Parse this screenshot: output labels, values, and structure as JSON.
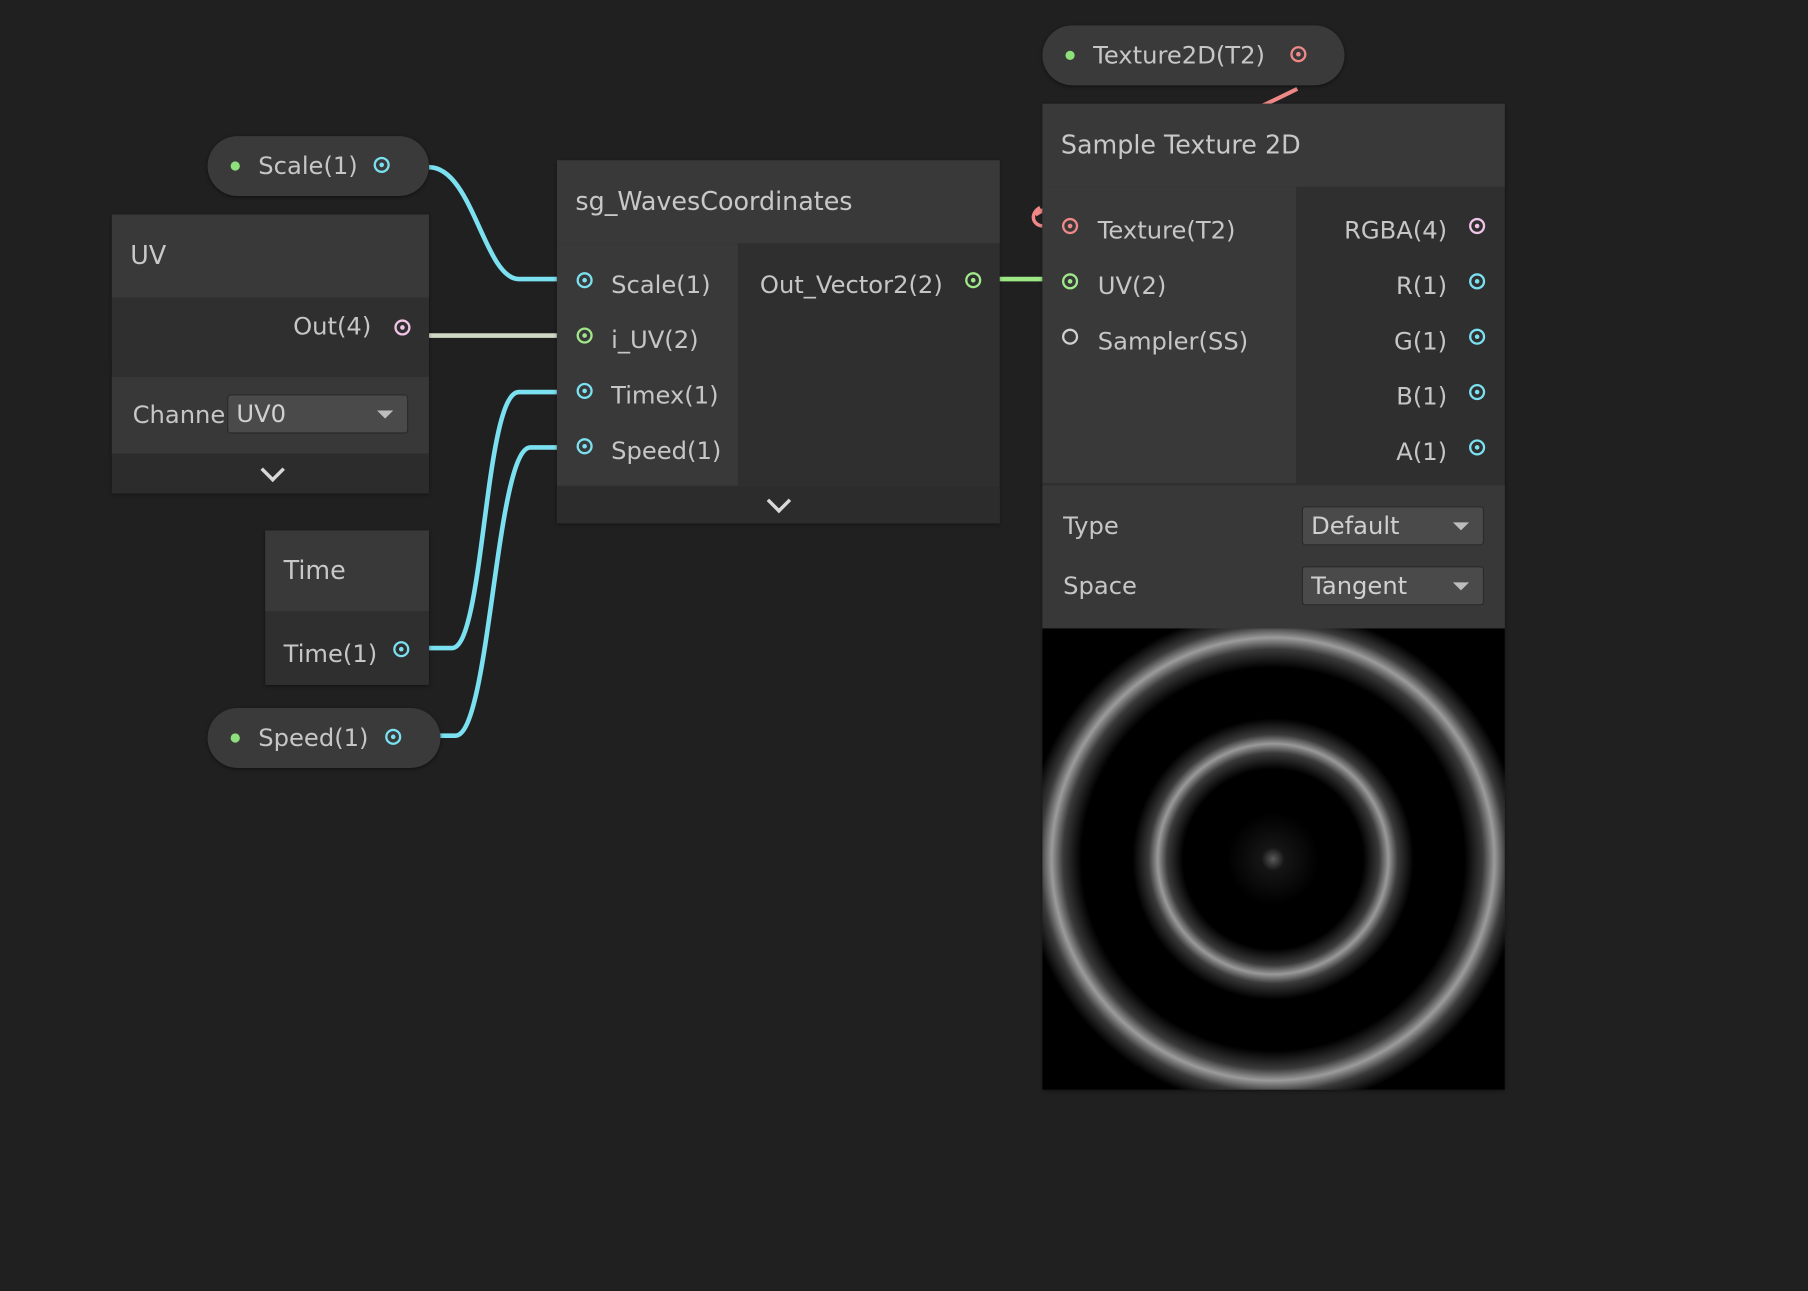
{
  "properties": {
    "scale": {
      "label": "Scale(1)"
    },
    "speed": {
      "label": "Speed(1)"
    },
    "texture2d": {
      "label": "Texture2D(T2)"
    }
  },
  "uv_node": {
    "title": "UV",
    "output_label": "Out(4)",
    "channel_label": "Channe",
    "channel_value": "UV0"
  },
  "time_node": {
    "title": "Time",
    "output_label": "Time(1)"
  },
  "waves_node": {
    "title": "sg_WavesCoordinates",
    "inputs": [
      "Scale(1)",
      "i_UV(2)",
      "Timex(1)",
      "Speed(1)"
    ],
    "output_label": "Out_Vector2(2)"
  },
  "sample_node": {
    "title": "Sample Texture 2D",
    "inputs": [
      "Texture(T2)",
      "UV(2)",
      "Sampler(SS)"
    ],
    "outputs": [
      "RGBA(4)",
      "R(1)",
      "G(1)",
      "B(1)",
      "A(1)"
    ],
    "type_label": "Type",
    "type_value": "Default",
    "space_label": "Space",
    "space_value": "Tangent"
  },
  "colors": {
    "background": "#202020",
    "float_port": "#7be0f0",
    "vector2_port": "#a0e88a",
    "vector4_port": "#f0c4e6",
    "texture_port": "#f08888"
  }
}
